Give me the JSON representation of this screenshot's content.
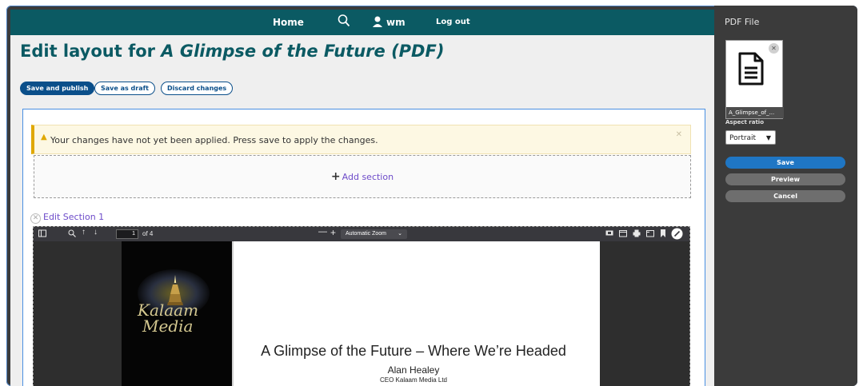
{
  "nav": {
    "home": "Home",
    "user": "wm",
    "logout": "Log out"
  },
  "page": {
    "title_prefix": "Edit layout for ",
    "title_italic": "A Glimpse of the Future (PDF)"
  },
  "actions": {
    "save_publish": "Save and publish",
    "save_draft": "Save as draft",
    "discard": "Discard changes"
  },
  "warning": {
    "icon": "warning-icon",
    "text": "Your changes have not yet been applied. Press save to apply the changes.",
    "close": "✕"
  },
  "add_section": {
    "plus": "+",
    "label": "Add section"
  },
  "edit_section": {
    "x": "✕",
    "label": "Edit Section 1"
  },
  "viewer": {
    "page": "1",
    "of": "of 4",
    "zoom": "Automatic Zoom"
  },
  "slide": {
    "logo_line1": "Kalaam",
    "logo_line2": "Media",
    "title": "A Glimpse of the Future – Where We’re Headed",
    "author": "Alan Healey",
    "role": "CEO Kalaam Media Ltd"
  },
  "sidebar": {
    "heading": "PDF File",
    "file_name": "A_Glimpse_of_...",
    "aspect_label": "Aspect ratio",
    "aspect_value": "Portrait",
    "save": "Save",
    "preview": "Preview",
    "cancel": "Cancel"
  },
  "colors": {
    "brand": "#0b5a63",
    "primary_button": "#0b4f8a",
    "link": "#6d4bc9",
    "warning_accent": "#e0a800",
    "save_button": "#1f76c4",
    "secondary_button": "#6e6e6e"
  }
}
